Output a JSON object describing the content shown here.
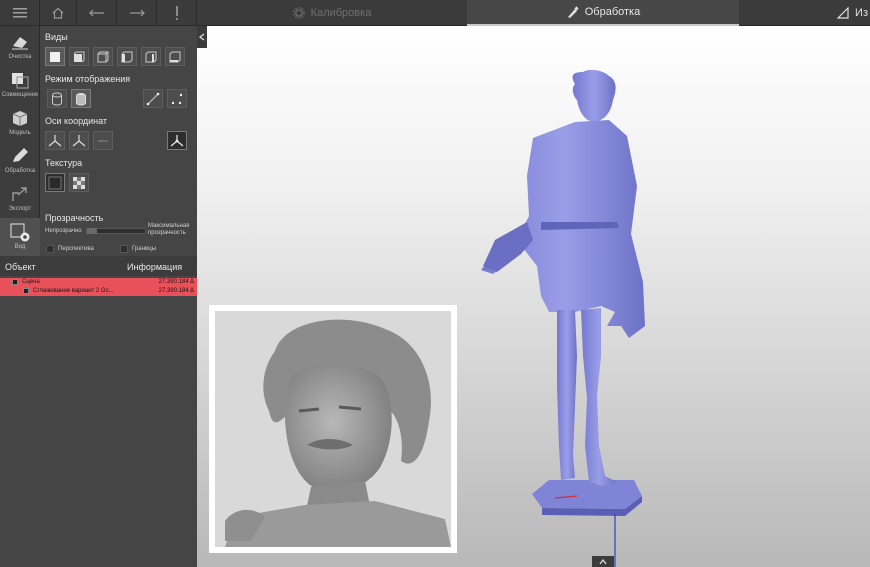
{
  "toolbar": {
    "tabs": [
      {
        "label": "Калибровка",
        "icon": "gear-icon",
        "active": false
      },
      {
        "label": "Обработка",
        "icon": "brush-icon",
        "active": true
      },
      {
        "label": "Из",
        "icon": "ruler-icon",
        "active": false
      }
    ]
  },
  "sidebar": {
    "items": [
      {
        "label": "Очистка",
        "icon": "eraser-icon"
      },
      {
        "label": "Совмещение",
        "icon": "align-icon"
      },
      {
        "label": "Модель",
        "icon": "cube-icon"
      },
      {
        "label": "Обработка",
        "icon": "pencil-icon"
      },
      {
        "label": "Экспорт",
        "icon": "export-icon"
      },
      {
        "label": "Вид",
        "icon": "view-icon"
      }
    ]
  },
  "panel": {
    "views_title": "Виды",
    "display_mode_title": "Режим отображения",
    "axes_title": "Оси координат",
    "texture_title": "Текстура",
    "transparency_title": "Прозрачность",
    "opaque_label": "Непрозрачно",
    "max_transparency_label": "Максимальная прозрачность",
    "perspective_label": "Перспектива",
    "borders_label": "Границы",
    "transparency_level": 0.0
  },
  "objects": {
    "header_object": "Объект",
    "header_info": "Информация",
    "rows": [
      {
        "name": "Сцена",
        "value": "27.390.184 Δ",
        "checked": true
      },
      {
        "name": "Сглаживание вариант 2 Gc...",
        "value": "27.390.184 Δ",
        "checked": true
      }
    ]
  },
  "colors": {
    "accent_row": "#e8505a",
    "model_color": "#8a8ee0",
    "inset_model": "#9a9a9a"
  }
}
